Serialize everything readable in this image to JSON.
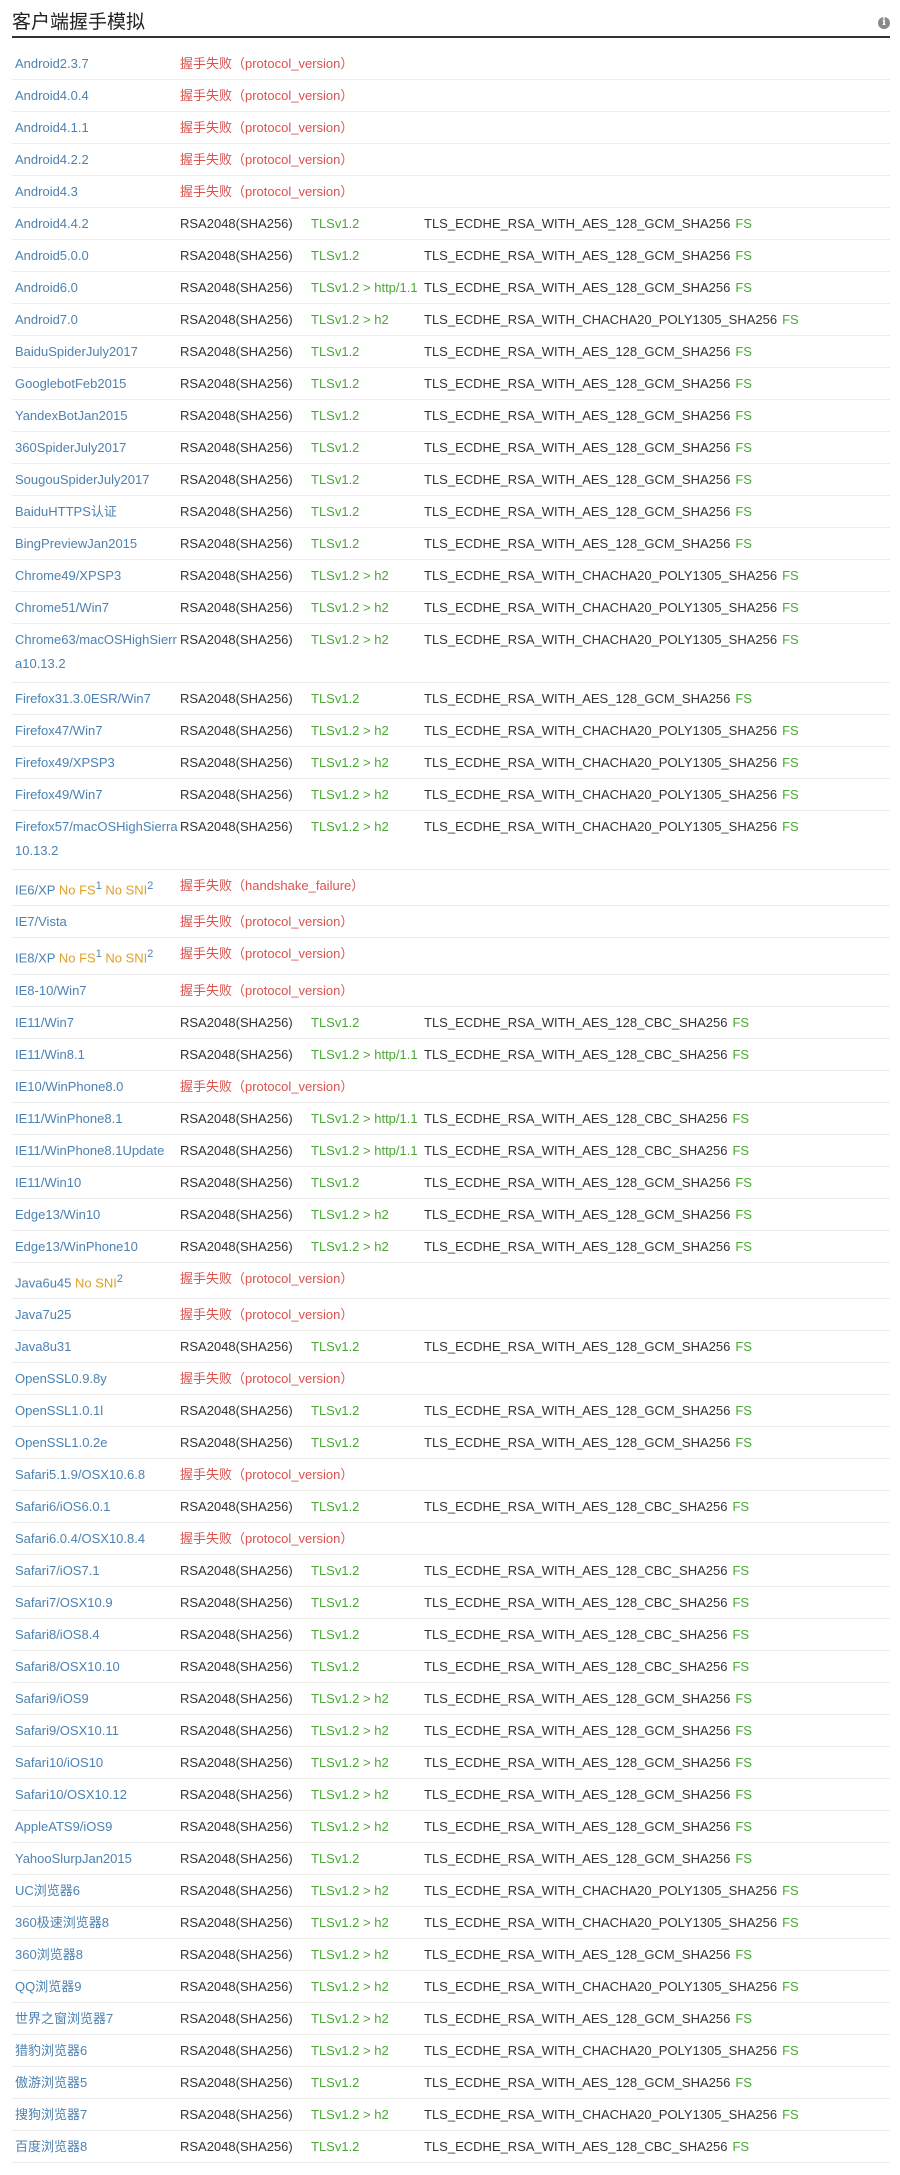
{
  "header": {
    "title": "客户端握手模拟",
    "info_icon": "i"
  },
  "rows": [
    {
      "client": "Android2.3.7",
      "fail": "握手失败（protocol_version）"
    },
    {
      "client": "Android4.0.4",
      "fail": "握手失败（protocol_version）"
    },
    {
      "client": "Android4.1.1",
      "fail": "握手失败（protocol_version）"
    },
    {
      "client": "Android4.2.2",
      "fail": "握手失败（protocol_version）"
    },
    {
      "client": "Android4.3",
      "fail": "握手失败（protocol_version）"
    },
    {
      "client": "Android4.4.2",
      "cert": "RSA2048(SHA256)",
      "proto": "TLSv1.2",
      "cipher": "TLS_ECDHE_RSA_WITH_AES_128_GCM_SHA256",
      "fs": "FS"
    },
    {
      "client": "Android5.0.0",
      "cert": "RSA2048(SHA256)",
      "proto": "TLSv1.2",
      "cipher": "TLS_ECDHE_RSA_WITH_AES_128_GCM_SHA256",
      "fs": "FS"
    },
    {
      "client": "Android6.0",
      "cert": "RSA2048(SHA256)",
      "proto": "TLSv1.2 > http/1.1",
      "cipher": "TLS_ECDHE_RSA_WITH_AES_128_GCM_SHA256",
      "fs": "FS"
    },
    {
      "client": "Android7.0",
      "cert": "RSA2048(SHA256)",
      "proto": "TLSv1.2 > h2",
      "cipher": "TLS_ECDHE_RSA_WITH_CHACHA20_POLY1305_SHA256",
      "fs": "FS"
    },
    {
      "client": "BaiduSpiderJuly2017",
      "cert": "RSA2048(SHA256)",
      "proto": "TLSv1.2",
      "cipher": "TLS_ECDHE_RSA_WITH_AES_128_GCM_SHA256",
      "fs": "FS"
    },
    {
      "client": "GooglebotFeb2015",
      "cert": "RSA2048(SHA256)",
      "proto": "TLSv1.2",
      "cipher": "TLS_ECDHE_RSA_WITH_AES_128_GCM_SHA256",
      "fs": "FS"
    },
    {
      "client": "YandexBotJan2015",
      "cert": "RSA2048(SHA256)",
      "proto": "TLSv1.2",
      "cipher": "TLS_ECDHE_RSA_WITH_AES_128_GCM_SHA256",
      "fs": "FS"
    },
    {
      "client": "360SpiderJuly2017",
      "cert": "RSA2048(SHA256)",
      "proto": "TLSv1.2",
      "cipher": "TLS_ECDHE_RSA_WITH_AES_128_GCM_SHA256",
      "fs": "FS"
    },
    {
      "client": "SougouSpiderJuly2017",
      "cert": "RSA2048(SHA256)",
      "proto": "TLSv1.2",
      "cipher": "TLS_ECDHE_RSA_WITH_AES_128_GCM_SHA256",
      "fs": "FS"
    },
    {
      "client": "BaiduHTTPS认证",
      "cert": "RSA2048(SHA256)",
      "proto": "TLSv1.2",
      "cipher": "TLS_ECDHE_RSA_WITH_AES_128_GCM_SHA256",
      "fs": "FS"
    },
    {
      "client": "BingPreviewJan2015",
      "cert": "RSA2048(SHA256)",
      "proto": "TLSv1.2",
      "cipher": "TLS_ECDHE_RSA_WITH_AES_128_GCM_SHA256",
      "fs": "FS"
    },
    {
      "client": "Chrome49/XPSP3",
      "cert": "RSA2048(SHA256)",
      "proto": "TLSv1.2 > h2",
      "cipher": "TLS_ECDHE_RSA_WITH_CHACHA20_POLY1305_SHA256",
      "fs": "FS"
    },
    {
      "client": "Chrome51/Win7",
      "cert": "RSA2048(SHA256)",
      "proto": "TLSv1.2 > h2",
      "cipher": "TLS_ECDHE_RSA_WITH_CHACHA20_POLY1305_SHA256",
      "fs": "FS"
    },
    {
      "client": "Chrome63/macOSHighSierra10.13.2",
      "cert": "RSA2048(SHA256)",
      "proto": "TLSv1.2 > h2",
      "cipher": "TLS_ECDHE_RSA_WITH_CHACHA20_POLY1305_SHA256",
      "fs": "FS",
      "wrap": true
    },
    {
      "client": "Firefox31.3.0ESR/Win7",
      "cert": "RSA2048(SHA256)",
      "proto": "TLSv1.2",
      "cipher": "TLS_ECDHE_RSA_WITH_AES_128_GCM_SHA256",
      "fs": "FS"
    },
    {
      "client": "Firefox47/Win7",
      "cert": "RSA2048(SHA256)",
      "proto": "TLSv1.2 > h2",
      "cipher": "TLS_ECDHE_RSA_WITH_CHACHA20_POLY1305_SHA256",
      "fs": "FS"
    },
    {
      "client": "Firefox49/XPSP3",
      "cert": "RSA2048(SHA256)",
      "proto": "TLSv1.2 > h2",
      "cipher": "TLS_ECDHE_RSA_WITH_CHACHA20_POLY1305_SHA256",
      "fs": "FS"
    },
    {
      "client": "Firefox49/Win7",
      "cert": "RSA2048(SHA256)",
      "proto": "TLSv1.2 > h2",
      "cipher": "TLS_ECDHE_RSA_WITH_CHACHA20_POLY1305_SHA256",
      "fs": "FS"
    },
    {
      "client": "Firefox57/macOSHighSierra10.13.2",
      "cert": "RSA2048(SHA256)",
      "proto": "TLSv1.2 > h2",
      "cipher": "TLS_ECDHE_RSA_WITH_CHACHA20_POLY1305_SHA256",
      "fs": "FS",
      "wrap": true
    },
    {
      "client": "IE6/XP",
      "warn": "No FS",
      "warn_sup": "1",
      "warn2": "No SNI",
      "warn2_sup": "2",
      "fail": "握手失败（handshake_failure）"
    },
    {
      "client": "IE7/Vista",
      "fail": "握手失败（protocol_version）"
    },
    {
      "client": "IE8/XP",
      "warn": "No FS",
      "warn_sup": "1",
      "warn2": "No SNI",
      "warn2_sup": "2",
      "fail": "握手失败（protocol_version）"
    },
    {
      "client": "IE8-10/Win7",
      "fail": "握手失败（protocol_version）"
    },
    {
      "client": "IE11/Win7",
      "cert": "RSA2048(SHA256)",
      "proto": "TLSv1.2",
      "cipher": "TLS_ECDHE_RSA_WITH_AES_128_CBC_SHA256",
      "fs": "FS"
    },
    {
      "client": "IE11/Win8.1",
      "cert": "RSA2048(SHA256)",
      "proto": "TLSv1.2 > http/1.1",
      "cipher": "TLS_ECDHE_RSA_WITH_AES_128_CBC_SHA256",
      "fs": "FS"
    },
    {
      "client": "IE10/WinPhone8.0",
      "fail": "握手失败（protocol_version）"
    },
    {
      "client": "IE11/WinPhone8.1",
      "cert": "RSA2048(SHA256)",
      "proto": "TLSv1.2 > http/1.1",
      "cipher": "TLS_ECDHE_RSA_WITH_AES_128_CBC_SHA256",
      "fs": "FS"
    },
    {
      "client": "IE11/WinPhone8.1Update",
      "cert": "RSA2048(SHA256)",
      "proto": "TLSv1.2 > http/1.1",
      "cipher": "TLS_ECDHE_RSA_WITH_AES_128_CBC_SHA256",
      "fs": "FS"
    },
    {
      "client": "IE11/Win10",
      "cert": "RSA2048(SHA256)",
      "proto": "TLSv1.2",
      "cipher": "TLS_ECDHE_RSA_WITH_AES_128_GCM_SHA256",
      "fs": "FS"
    },
    {
      "client": "Edge13/Win10",
      "cert": "RSA2048(SHA256)",
      "proto": "TLSv1.2 > h2",
      "cipher": "TLS_ECDHE_RSA_WITH_AES_128_GCM_SHA256",
      "fs": "FS"
    },
    {
      "client": "Edge13/WinPhone10",
      "cert": "RSA2048(SHA256)",
      "proto": "TLSv1.2 > h2",
      "cipher": "TLS_ECDHE_RSA_WITH_AES_128_GCM_SHA256",
      "fs": "FS"
    },
    {
      "client": "Java6u45",
      "warn": "No SNI",
      "warn_sup": "2",
      "fail": "握手失败（protocol_version）"
    },
    {
      "client": "Java7u25",
      "fail": "握手失败（protocol_version）"
    },
    {
      "client": "Java8u31",
      "cert": "RSA2048(SHA256)",
      "proto": "TLSv1.2",
      "cipher": "TLS_ECDHE_RSA_WITH_AES_128_GCM_SHA256",
      "fs": "FS"
    },
    {
      "client": "OpenSSL0.9.8y",
      "fail": "握手失败（protocol_version）"
    },
    {
      "client": "OpenSSL1.0.1l",
      "cert": "RSA2048(SHA256)",
      "proto": "TLSv1.2",
      "cipher": "TLS_ECDHE_RSA_WITH_AES_128_GCM_SHA256",
      "fs": "FS"
    },
    {
      "client": "OpenSSL1.0.2e",
      "cert": "RSA2048(SHA256)",
      "proto": "TLSv1.2",
      "cipher": "TLS_ECDHE_RSA_WITH_AES_128_GCM_SHA256",
      "fs": "FS"
    },
    {
      "client": "Safari5.1.9/OSX10.6.8",
      "fail": "握手失败（protocol_version）"
    },
    {
      "client": "Safari6/iOS6.0.1",
      "cert": "RSA2048(SHA256)",
      "proto": "TLSv1.2",
      "cipher": "TLS_ECDHE_RSA_WITH_AES_128_CBC_SHA256",
      "fs": "FS"
    },
    {
      "client": "Safari6.0.4/OSX10.8.4",
      "fail": "握手失败（protocol_version）"
    },
    {
      "client": "Safari7/iOS7.1",
      "cert": "RSA2048(SHA256)",
      "proto": "TLSv1.2",
      "cipher": "TLS_ECDHE_RSA_WITH_AES_128_CBC_SHA256",
      "fs": "FS"
    },
    {
      "client": "Safari7/OSX10.9",
      "cert": "RSA2048(SHA256)",
      "proto": "TLSv1.2",
      "cipher": "TLS_ECDHE_RSA_WITH_AES_128_CBC_SHA256",
      "fs": "FS"
    },
    {
      "client": "Safari8/iOS8.4",
      "cert": "RSA2048(SHA256)",
      "proto": "TLSv1.2",
      "cipher": "TLS_ECDHE_RSA_WITH_AES_128_CBC_SHA256",
      "fs": "FS"
    },
    {
      "client": "Safari8/OSX10.10",
      "cert": "RSA2048(SHA256)",
      "proto": "TLSv1.2",
      "cipher": "TLS_ECDHE_RSA_WITH_AES_128_CBC_SHA256",
      "fs": "FS"
    },
    {
      "client": "Safari9/iOS9",
      "cert": "RSA2048(SHA256)",
      "proto": "TLSv1.2 > h2",
      "cipher": "TLS_ECDHE_RSA_WITH_AES_128_GCM_SHA256",
      "fs": "FS"
    },
    {
      "client": "Safari9/OSX10.11",
      "cert": "RSA2048(SHA256)",
      "proto": "TLSv1.2 > h2",
      "cipher": "TLS_ECDHE_RSA_WITH_AES_128_GCM_SHA256",
      "fs": "FS"
    },
    {
      "client": "Safari10/iOS10",
      "cert": "RSA2048(SHA256)",
      "proto": "TLSv1.2 > h2",
      "cipher": "TLS_ECDHE_RSA_WITH_AES_128_GCM_SHA256",
      "fs": "FS"
    },
    {
      "client": "Safari10/OSX10.12",
      "cert": "RSA2048(SHA256)",
      "proto": "TLSv1.2 > h2",
      "cipher": "TLS_ECDHE_RSA_WITH_AES_128_GCM_SHA256",
      "fs": "FS"
    },
    {
      "client": "AppleATS9/iOS9",
      "cert": "RSA2048(SHA256)",
      "proto": "TLSv1.2 > h2",
      "cipher": "TLS_ECDHE_RSA_WITH_AES_128_GCM_SHA256",
      "fs": "FS"
    },
    {
      "client": "YahooSlurpJan2015",
      "cert": "RSA2048(SHA256)",
      "proto": "TLSv1.2",
      "cipher": "TLS_ECDHE_RSA_WITH_AES_128_GCM_SHA256",
      "fs": "FS"
    },
    {
      "client": "UC浏览器6",
      "cert": "RSA2048(SHA256)",
      "proto": "TLSv1.2 > h2",
      "cipher": "TLS_ECDHE_RSA_WITH_CHACHA20_POLY1305_SHA256",
      "fs": "FS"
    },
    {
      "client": "360极速浏览器8",
      "cert": "RSA2048(SHA256)",
      "proto": "TLSv1.2 > h2",
      "cipher": "TLS_ECDHE_RSA_WITH_CHACHA20_POLY1305_SHA256",
      "fs": "FS"
    },
    {
      "client": "360浏览器8",
      "cert": "RSA2048(SHA256)",
      "proto": "TLSv1.2 > h2",
      "cipher": "TLS_ECDHE_RSA_WITH_AES_128_GCM_SHA256",
      "fs": "FS"
    },
    {
      "client": "QQ浏览器9",
      "cert": "RSA2048(SHA256)",
      "proto": "TLSv1.2 > h2",
      "cipher": "TLS_ECDHE_RSA_WITH_CHACHA20_POLY1305_SHA256",
      "fs": "FS"
    },
    {
      "client": "世界之窗浏览器7",
      "cert": "RSA2048(SHA256)",
      "proto": "TLSv1.2 > h2",
      "cipher": "TLS_ECDHE_RSA_WITH_AES_128_GCM_SHA256",
      "fs": "FS"
    },
    {
      "client": "猎豹浏览器6",
      "cert": "RSA2048(SHA256)",
      "proto": "TLSv1.2 > h2",
      "cipher": "TLS_ECDHE_RSA_WITH_CHACHA20_POLY1305_SHA256",
      "fs": "FS"
    },
    {
      "client": "傲游浏览器5",
      "cert": "RSA2048(SHA256)",
      "proto": "TLSv1.2",
      "cipher": "TLS_ECDHE_RSA_WITH_AES_128_GCM_SHA256",
      "fs": "FS"
    },
    {
      "client": "搜狗浏览器7",
      "cert": "RSA2048(SHA256)",
      "proto": "TLSv1.2 > h2",
      "cipher": "TLS_ECDHE_RSA_WITH_CHACHA20_POLY1305_SHA256",
      "fs": "FS"
    },
    {
      "client": "百度浏览器8",
      "cert": "RSA2048(SHA256)",
      "proto": "TLSv1.2",
      "cipher": "TLS_ECDHE_RSA_WITH_AES_128_CBC_SHA256",
      "fs": "FS"
    }
  ]
}
